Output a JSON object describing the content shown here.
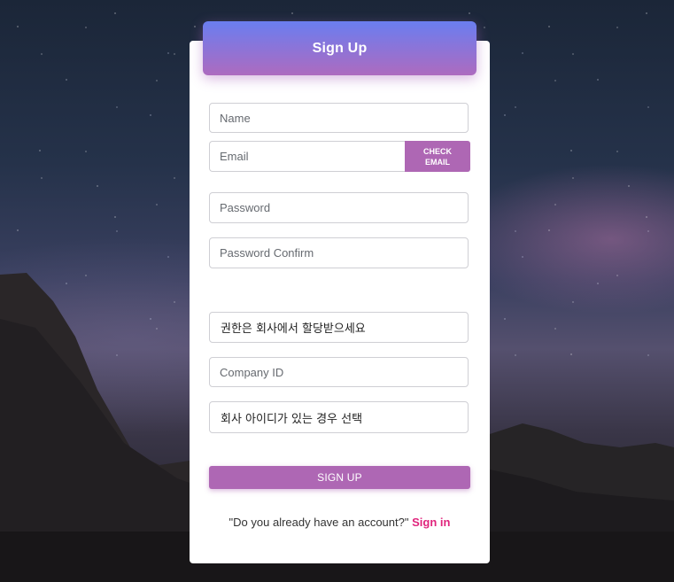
{
  "header": {
    "title": "Sign Up"
  },
  "form": {
    "name_placeholder": "Name",
    "email_placeholder": "Email",
    "check_email_line1": "CHECK",
    "check_email_line2": "EMAIL",
    "password_placeholder": "Password",
    "password_confirm_placeholder": "Password Confirm",
    "role_select_value": "권한은 회사에서 할당받으세요",
    "company_id_placeholder": "Company ID",
    "company_select_value": "회사 아이디가 있는 경우 선택",
    "submit_label": "SIGN UP"
  },
  "footer": {
    "prompt": "\"Do you already have an account?\"",
    "signin_label": "Sign in"
  },
  "colors": {
    "accent": "#ae67b4",
    "header_gradient_start": "#6a7ef0",
    "header_gradient_end": "#ad6bbf",
    "link": "#e0247c"
  }
}
